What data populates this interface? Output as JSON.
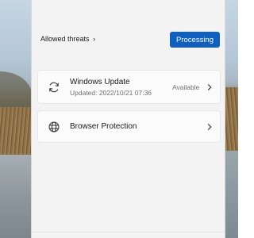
{
  "threats": {
    "link_label": "Allowed threats",
    "chevron": "›",
    "action_button": "Processing"
  },
  "cards": {
    "windows_update": {
      "icon": "sync-icon",
      "title": "Windows Update",
      "subtitle": "Updated: 2022/10/21 07:36",
      "status": "Available"
    },
    "browser_protection": {
      "icon": "globe-icon",
      "title": "Browser Protection"
    }
  },
  "colors": {
    "accent": "#0f5fbe",
    "panel_bg": "#f3f3f3",
    "card_bg": "#fbfbfb"
  }
}
